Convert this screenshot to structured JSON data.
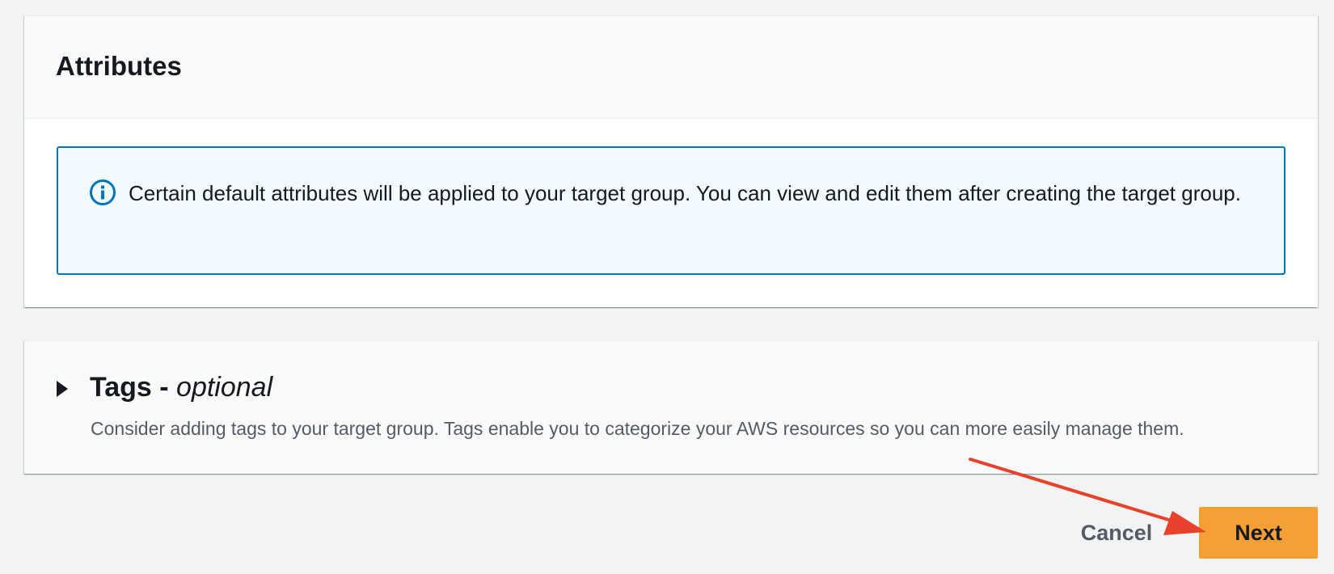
{
  "attributes": {
    "title": "Attributes",
    "info_message": "Certain default attributes will be applied to your target group. You can view and edit them after creating the target group.",
    "info_icon": "info-icon"
  },
  "tags": {
    "title": "Tags - ",
    "title_optional": "optional",
    "description": "Consider adding tags to your target group. Tags enable you to categorize your AWS resources so you can more easily manage them.",
    "expand_icon": "caret-right-icon"
  },
  "footer": {
    "cancel_label": "Cancel",
    "next_label": "Next"
  },
  "colors": {
    "primary_button": "#f69f35",
    "info_border": "#0073bb",
    "info_background": "#f1faff",
    "annotation_arrow": "#e8412c"
  }
}
